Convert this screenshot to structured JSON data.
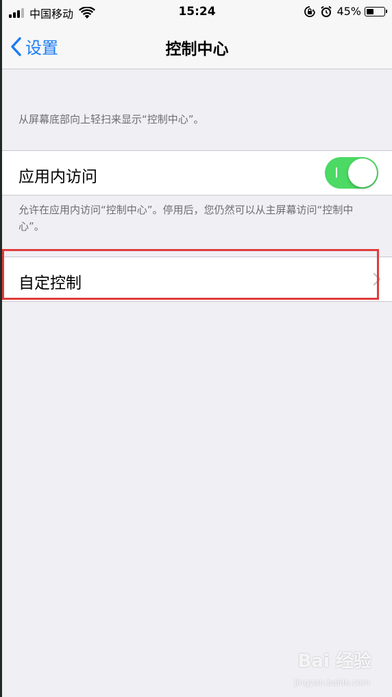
{
  "status_bar": {
    "carrier": "中国移动",
    "time": "15:24",
    "battery_percent": "45%",
    "battery_level": 0.45,
    "icons": [
      "signal-icon",
      "wifi-icon",
      "rotation-lock-icon",
      "alarm-icon",
      "battery-icon"
    ]
  },
  "nav": {
    "back_label": "设置",
    "title": "控制中心"
  },
  "content": {
    "intro_note": "从屏幕底部向上轻扫来显示“控制中心”。",
    "in_app_access": {
      "label": "应用内访问",
      "enabled": true
    },
    "in_app_note": "允许在应用内访问“控制中心”。停用后，您仍然可以从主屏幕访问“控制中心”。",
    "customize": {
      "label": "自定控制"
    }
  },
  "watermark": {
    "brand": "Bai  经验",
    "url": "jingyan.baidu.com"
  },
  "colors": {
    "accent": "#1a7cf5",
    "toggle_on": "#4cd964",
    "highlight": "#e03b3b",
    "background": "#efeff4"
  }
}
